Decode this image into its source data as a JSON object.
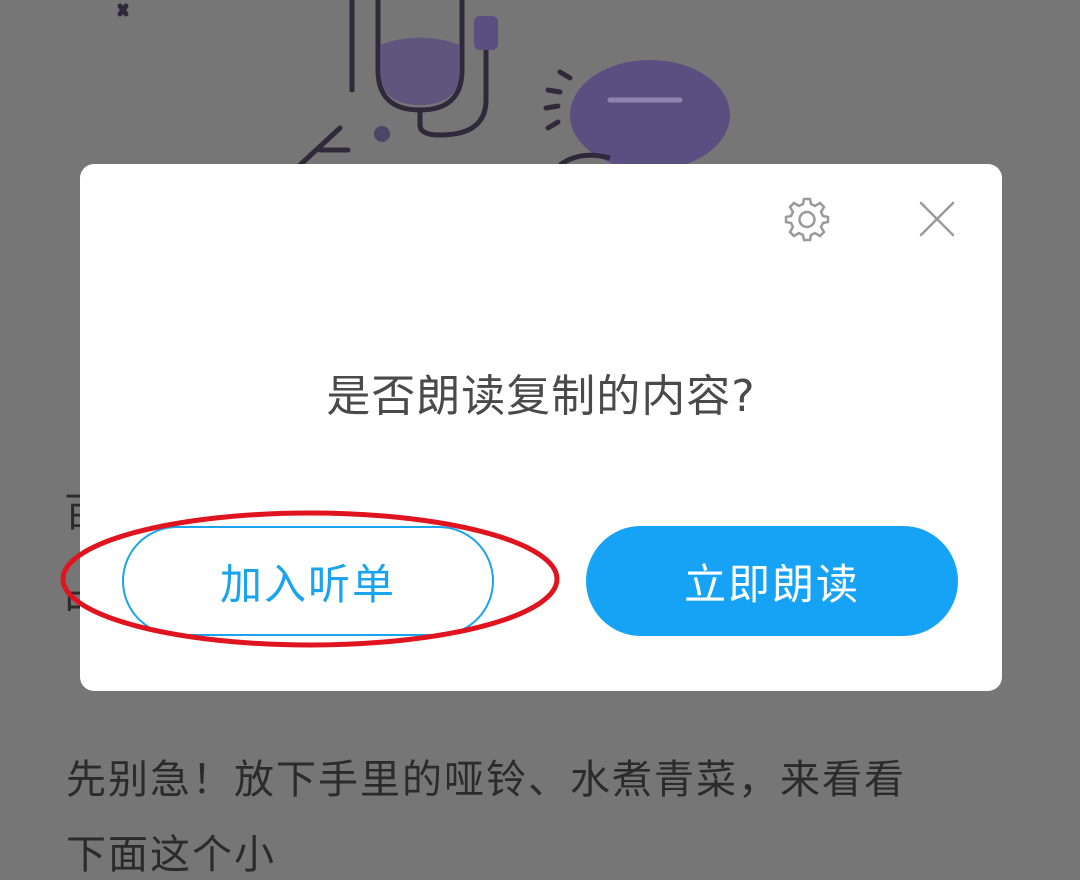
{
  "dialog": {
    "message": "是否朗读复制的内容?",
    "add_button_label": "加入听单",
    "read_now_button_label": "立即朗读",
    "settings_icon": "gear-icon",
    "close_icon": "close-icon"
  },
  "background": {
    "article_line1": "先别急！放下手里的哑铃、水煮青菜，来看看",
    "article_line2": "下面这个小",
    "edge_char1": "百",
    "edge_char2": "中"
  },
  "colors": {
    "accent": "#16a2f5",
    "annotation": "#e0141e",
    "overlay": "#767676"
  }
}
